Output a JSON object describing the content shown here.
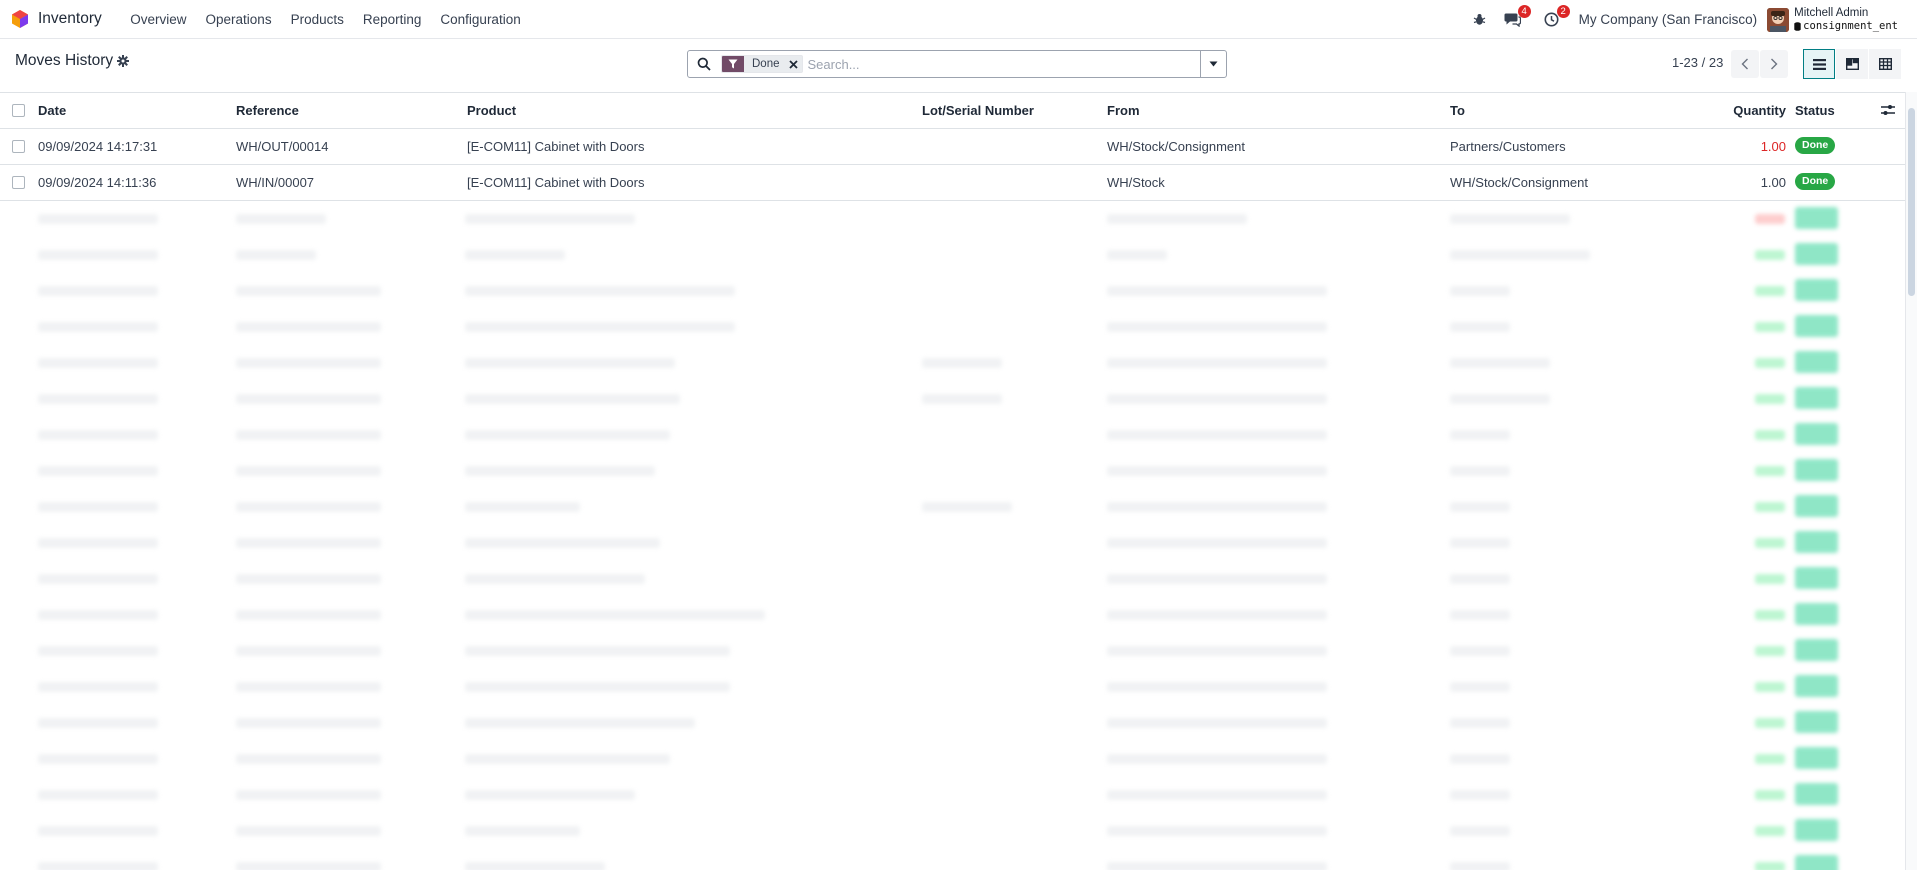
{
  "navbar": {
    "app_name": "Inventory",
    "menu": [
      "Overview",
      "Operations",
      "Products",
      "Reporting",
      "Configuration"
    ],
    "messages_count": "4",
    "activities_count": "2",
    "company": "My Company (San Francisco)",
    "user_name": "Mitchell Admin",
    "database": "consignment_ent"
  },
  "control": {
    "title": "Moves History",
    "facet": "Done",
    "search_placeholder": "Search...",
    "pager": "1-23 / 23"
  },
  "table": {
    "columns": {
      "date": "Date",
      "reference": "Reference",
      "product": "Product",
      "lot": "Lot/Serial Number",
      "from": "From",
      "to": "To",
      "quantity": "Quantity",
      "status": "Status"
    },
    "rows": [
      {
        "date": "09/09/2024 14:17:31",
        "reference": "WH/OUT/00014",
        "product": "[E-COM11] Cabinet with Doors",
        "lot": "",
        "from": "WH/Stock/Consignment",
        "to": "Partners/Customers",
        "quantity": "1.00",
        "status": "Done"
      },
      {
        "date": "09/09/2024 14:11:36",
        "reference": "WH/IN/00007",
        "product": "[E-COM11] Cabinet with Doors",
        "lot": "",
        "from": "WH/Stock",
        "to": "WH/Stock/Consignment",
        "quantity": "1.00",
        "status": "Done"
      }
    ]
  },
  "colors": {
    "brand": "#714b67",
    "accent": "#017e84",
    "negative_qty": "#dc2626",
    "done_badge": "#28a745"
  },
  "icons": [
    "app-logo-icon",
    "bug-icon",
    "chat-icon",
    "clock-icon",
    "gear-icon",
    "search-icon",
    "filter-icon",
    "close-icon",
    "caret-down-icon",
    "chevron-left-icon",
    "chevron-right-icon",
    "list-view-icon",
    "kanban-view-icon",
    "pivot-view-icon",
    "column-options-icon"
  ]
}
